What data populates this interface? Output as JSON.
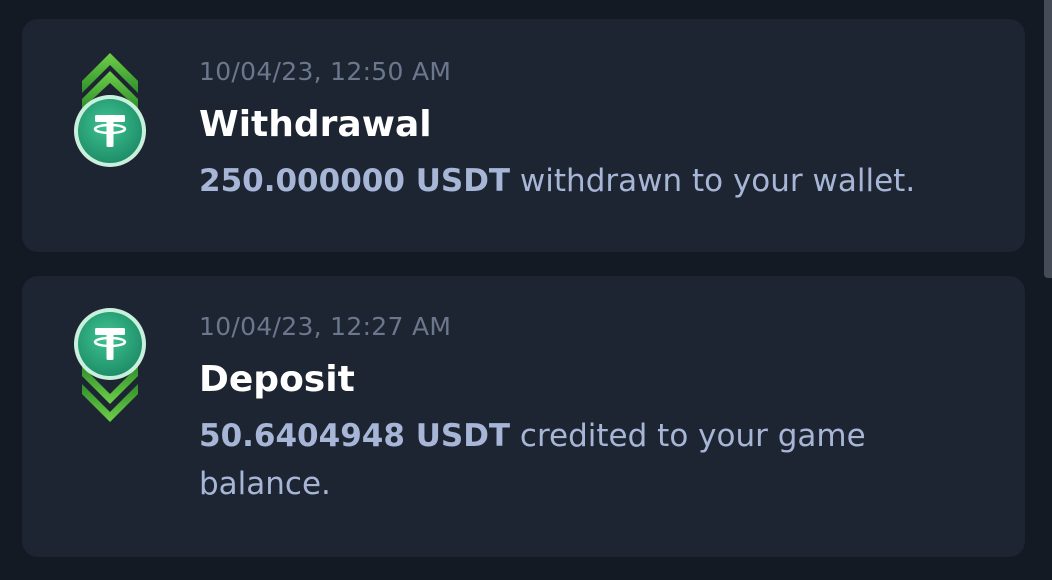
{
  "colors": {
    "background": "#141a24",
    "card": "#1e2532",
    "timestamp": "#6b778c",
    "title": "#ffffff",
    "message": "#a7b6d6",
    "tether_green": "#26a17b",
    "arrow_green": "#6cc24a"
  },
  "transactions": [
    {
      "type": "withdrawal",
      "icon": "tether-withdraw-icon",
      "timestamp": "10/04/23, 12:50 AM",
      "title": "Withdrawal",
      "amount": "250.000000 USDT",
      "message": " withdrawn to your wallet."
    },
    {
      "type": "deposit",
      "icon": "tether-deposit-icon",
      "timestamp": "10/04/23, 12:27 AM",
      "title": "Deposit",
      "amount": "50.6404948 USDT",
      "message": " credited to your game balance."
    }
  ]
}
